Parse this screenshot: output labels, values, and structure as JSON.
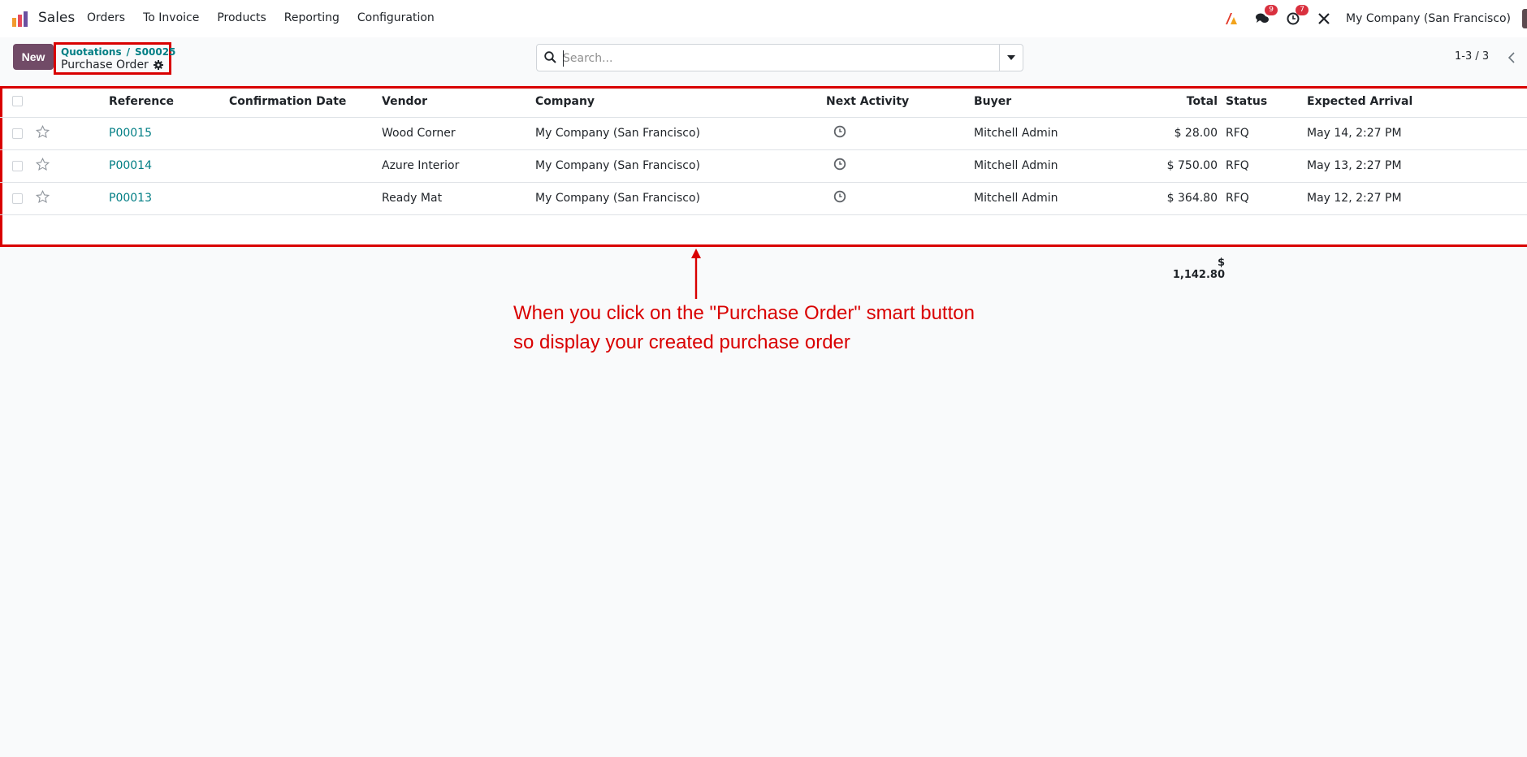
{
  "navbar": {
    "app_name": "Sales",
    "menu": [
      "Orders",
      "To Invoice",
      "Products",
      "Reporting",
      "Configuration"
    ],
    "messages_count": "9",
    "activities_count": "7",
    "company": "My Company (San Francisco)",
    "brand_color": "#714b67"
  },
  "control": {
    "new_label": "New",
    "breadcrumb": {
      "parent": "Quotations",
      "separator": "/",
      "record": "S00025",
      "current": "Purchase Order"
    },
    "search_placeholder": "Search...",
    "pager": "1-3 / 3"
  },
  "table": {
    "headers": {
      "reference": "Reference",
      "confirmation_date": "Confirmation Date",
      "vendor": "Vendor",
      "company": "Company",
      "next_activity": "Next Activity",
      "buyer": "Buyer",
      "total": "Total",
      "status": "Status",
      "expected_arrival": "Expected Arrival"
    },
    "rows": [
      {
        "reference": "P00015",
        "confirmation_date": "",
        "vendor": "Wood Corner",
        "company": "My Company (San Francisco)",
        "buyer": "Mitchell Admin",
        "total": "$ 28.00",
        "status": "RFQ",
        "expected_arrival": "May 14, 2:27 PM"
      },
      {
        "reference": "P00014",
        "confirmation_date": "",
        "vendor": "Azure Interior",
        "company": "My Company (San Francisco)",
        "buyer": "Mitchell Admin",
        "total": "$ 750.00",
        "status": "RFQ",
        "expected_arrival": "May 13, 2:27 PM"
      },
      {
        "reference": "P00013",
        "confirmation_date": "",
        "vendor": "Ready Mat",
        "company": "My Company (San Francisco)",
        "buyer": "Mitchell Admin",
        "total": "$ 364.80",
        "status": "RFQ",
        "expected_arrival": "May 12, 2:27 PM"
      }
    ],
    "total_sum": "$ 1,142.80",
    "link_color": "#017e84"
  },
  "annotation": {
    "line1": "When you click on the \"Purchase Order\" smart button",
    "line2": "so display your created purchase order",
    "color": "#d90000"
  }
}
